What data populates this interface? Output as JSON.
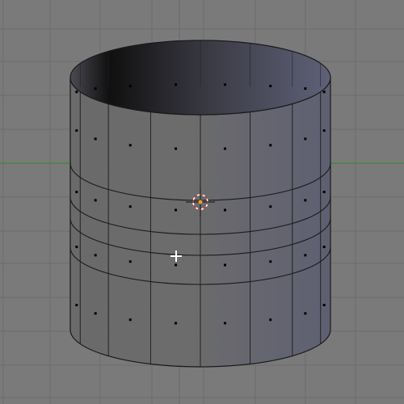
{
  "viewport": {
    "name": "3d-viewport",
    "background_color": "#7a7a7a",
    "grid_color": "#6c6c6c",
    "x_axis_color": "#2e8b2e"
  },
  "mesh": {
    "name": "cylinder-mesh",
    "mode": "edit",
    "face_light_color": "#6e6e6e",
    "face_dark_color": "#5a5a68",
    "interior_color": "#3a3c48",
    "edge_color": "#1a1a1a",
    "vertex_color": "#000000",
    "vertical_segments": 16,
    "horizontal_edge_loops": 4
  },
  "pivot": {
    "name": "object-origin-pivot",
    "color": "#c43a3a"
  },
  "cursor": {
    "name": "3d-cursor-crosshair",
    "color": "#ffffff"
  }
}
